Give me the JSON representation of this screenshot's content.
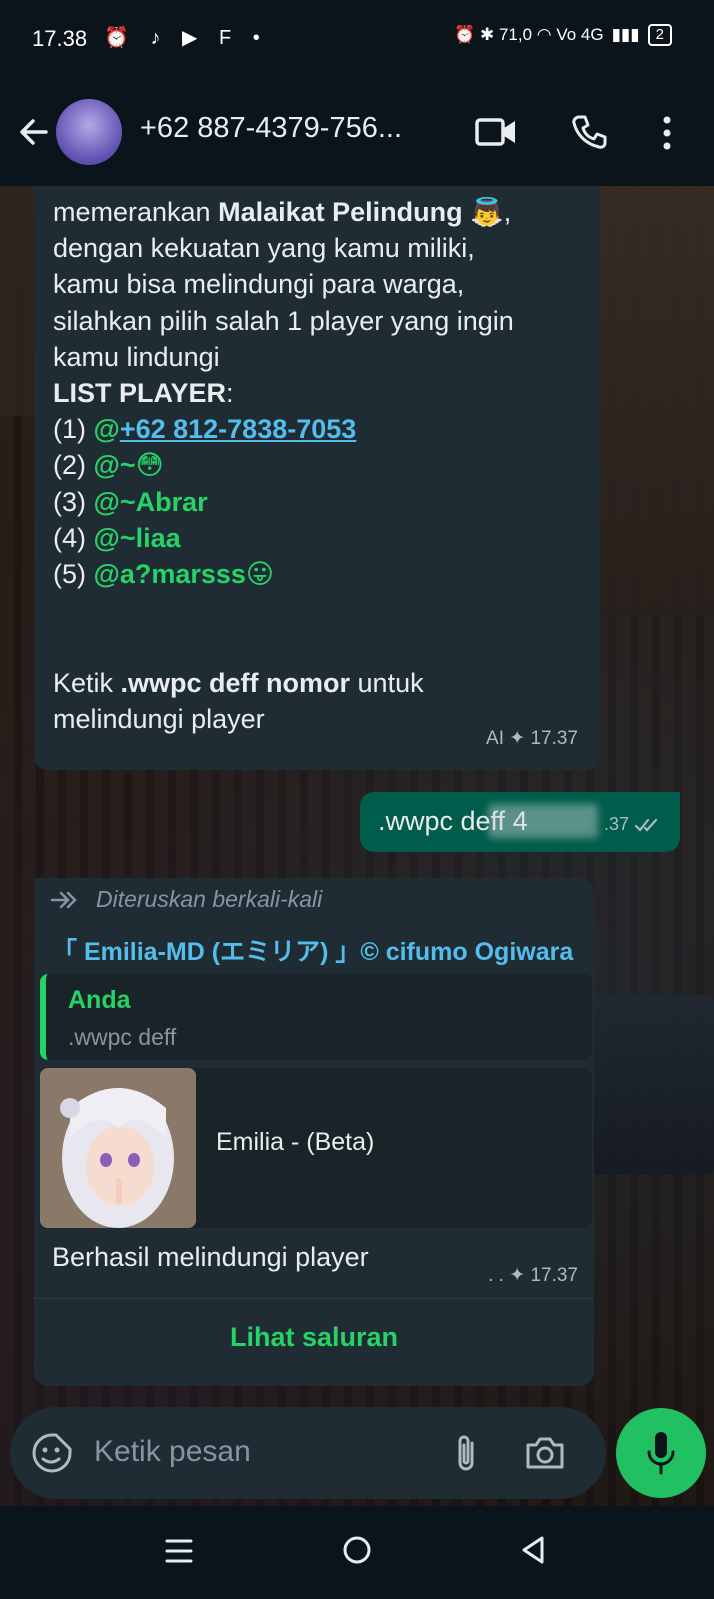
{
  "status_bar": {
    "time": "17.38",
    "left_icons": "⏰ ♪ ▶ F •",
    "right_text": "⏰ ✱ 71,0 ◠ Vo 4G",
    "battery": "2"
  },
  "header": {
    "title": "+62 887-4379-756..."
  },
  "message1": {
    "line1_pre": "memerankan ",
    "line1_bold": "Malaikat Pelindung",
    "line1_emoji": "👼",
    "line1_post": ",",
    "line2": "dengan kekuatan yang kamu miliki,",
    "line3": "kamu bisa melindungi para warga,",
    "line4": "silahkan pilih salah 1 player yang ingin",
    "line5": "kamu lindungi",
    "list_title": "LIST PLAYER",
    "list_colon": ":",
    "players": [
      {
        "num": "(1) ",
        "at": "@",
        "name": "+62 812-7838-7053",
        "link": true
      },
      {
        "num": "(2) ",
        "at": "@~",
        "name": "😳",
        "link": false
      },
      {
        "num": "(3) ",
        "at": "@~",
        "name": "Abrar",
        "link": false
      },
      {
        "num": "(4) ",
        "at": "@~",
        "name": "liaa",
        "link": false
      },
      {
        "num": "(5) ",
        "at": "@",
        "name": "a?marsss😛",
        "link": false
      }
    ],
    "instruction_pre": "Ketik ",
    "instruction_bold": ".wwpc deff nomor",
    "instruction_post": " untuk",
    "instruction_line2": "melindungi player",
    "meta": "AI ✦ 17.37"
  },
  "message2": {
    "text": ".wwpc deff 4",
    "meta": ".37"
  },
  "message3": {
    "forwarded": "Diteruskan berkali-kali",
    "sender": "「 Emilia-MD (エミリア) 」© cifumo Ogiwara",
    "quote_name": "Anda",
    "quote_text": ".wwpc deff",
    "preview_title": "Emilia - (Beta)",
    "text": "Berhasil melindungi player",
    "meta": ". . ✦ 17.37",
    "channel_button": "Lihat saluran"
  },
  "input": {
    "placeholder": "Ketik pesan"
  }
}
